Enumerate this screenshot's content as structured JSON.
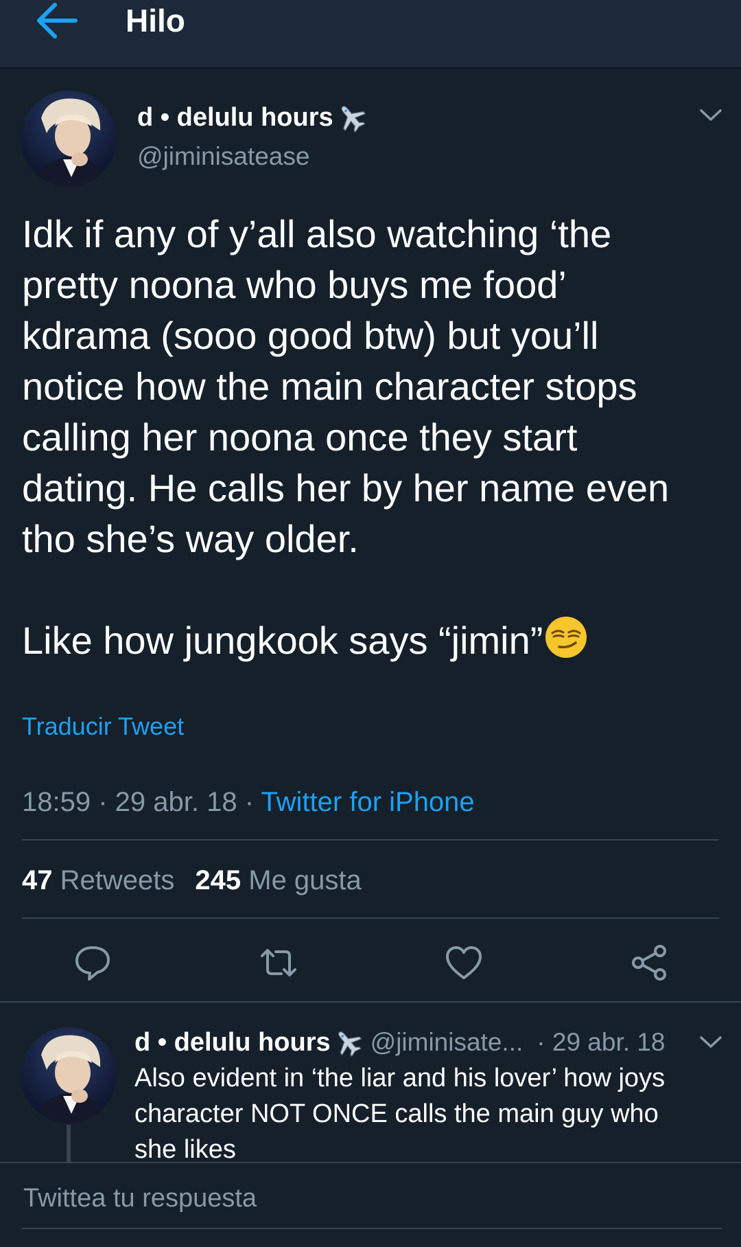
{
  "header": {
    "title": "Hilo"
  },
  "tweet": {
    "display_name": "d • delulu hours",
    "handle": "@jiminisatease",
    "text": "Idk if any of y’all also watching ‘the\npretty noona who buys me food’\nkdrama (sooo good btw) but you’ll\nnotice how the main character stops\ncalling her noona once they start\ndating. He calls her by her name even\ntho she’s way older.\n\nLike how jungkook says “jimin”",
    "translate_label": "Traducir Tweet",
    "time": "18:59",
    "date": "29 abr. 18",
    "source": "Twitter for iPhone",
    "retweets_count": "47",
    "retweets_label": "Retweets",
    "likes_count": "245",
    "likes_label": "Me gusta"
  },
  "reply": {
    "display_name": "d • delulu hours",
    "handle": "@jiminisate...",
    "date": "· 29 abr. 18",
    "text": "Also evident in ‘the liar and his lover’ how joys\ncharacter NOT ONCE calls the main guy who\nshe likes"
  },
  "compose": {
    "placeholder": "Twittea tu respuesta"
  },
  "colors": {
    "background": "#15202b",
    "header": "#1c2938",
    "accent": "#1da1f2",
    "muted": "#8899a6",
    "divider": "#38444d"
  },
  "icons": [
    "back-arrow-icon",
    "airplane-emoji-icon",
    "chevron-down-icon",
    "smirk-emoji-icon",
    "reply-icon",
    "retweet-icon",
    "like-heart-icon",
    "share-icon"
  ]
}
